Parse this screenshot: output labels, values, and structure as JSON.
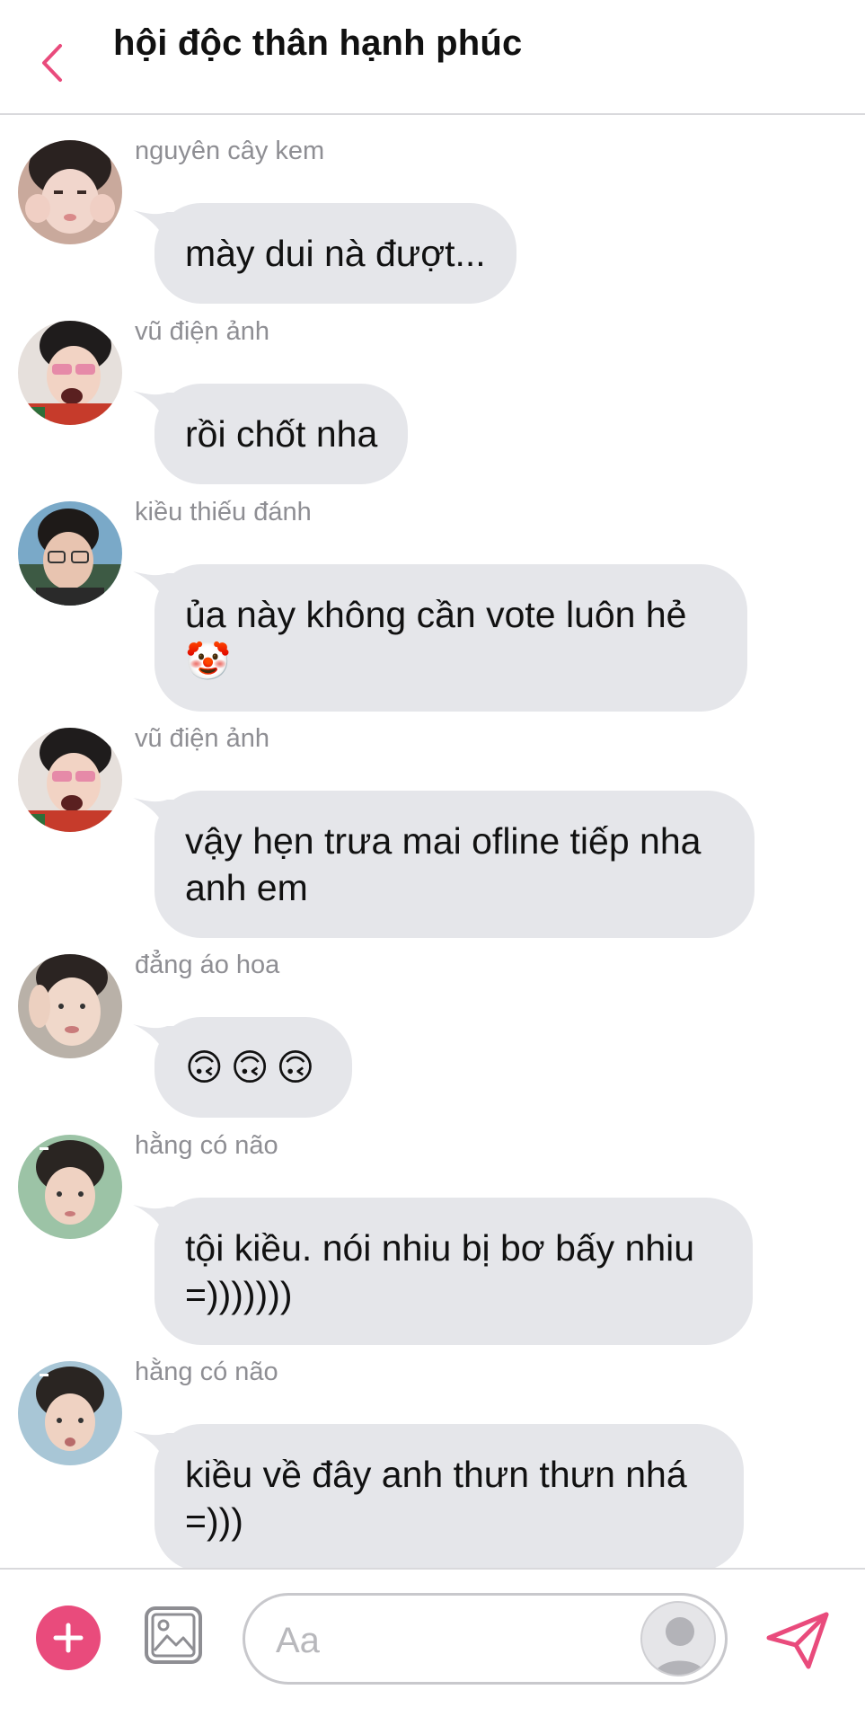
{
  "header": {
    "title": "hội độc thân hạnh phúc"
  },
  "messages": [
    {
      "sender": "nguyên cây kem",
      "text": "mày dui nà đượt..."
    },
    {
      "sender": "vũ điện ảnh",
      "text": "rồi chốt nha"
    },
    {
      "sender": "kiều thiếu đánh",
      "text": "ủa này không cần vote luôn hẻ 🤡"
    },
    {
      "sender": "vũ điện ảnh",
      "text": "vậy hẹn trưa mai ofline tiếp nha anh em"
    },
    {
      "sender": "đẳng áo hoa",
      "text": "🙃🙃🙃"
    },
    {
      "sender": "hằng có não",
      "text": "tội kiều. nói nhiu bị bơ bấy nhiu =)))))))"
    },
    {
      "sender": "hằng có não",
      "text": "kiều về đây anh thưn thưn nhá =)))"
    }
  ],
  "composer": {
    "placeholder": "Aa"
  },
  "colors": {
    "accent": "#e94b7c",
    "bubble": "#e5e6ea",
    "sender_text": "#8e8e93"
  },
  "icons": {
    "back": "chevron-left-icon",
    "plus": "plus-icon",
    "image": "image-icon",
    "send": "send-icon",
    "profile": "profile-avatar-icon"
  }
}
